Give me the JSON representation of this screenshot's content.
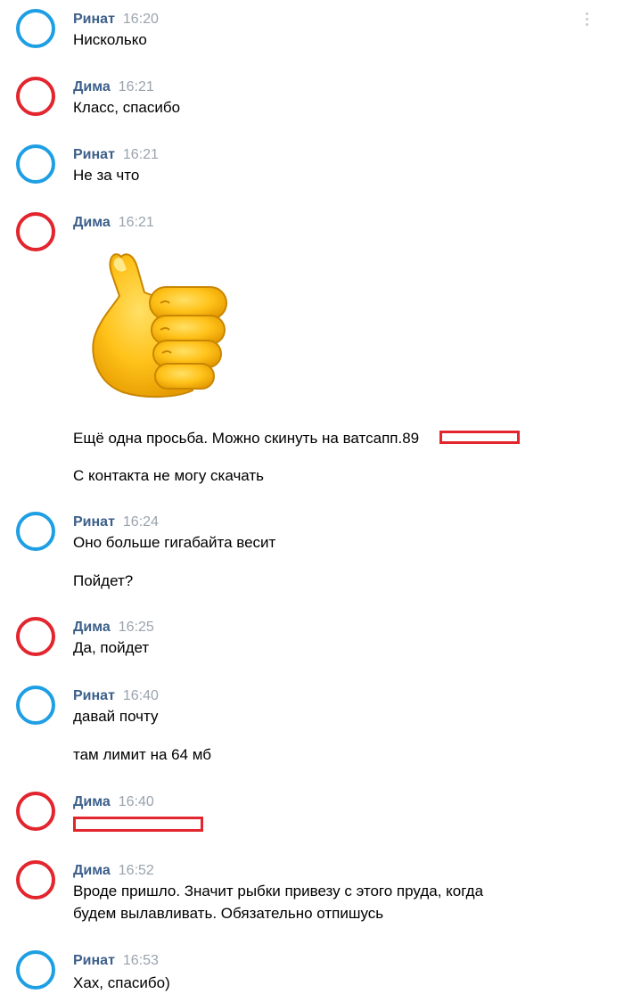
{
  "messages": [
    {
      "author": "Ринат",
      "time": "16:20",
      "lines": [
        "Нисколько"
      ]
    },
    {
      "author": "Дима",
      "time": "16:21",
      "lines": [
        "Класс, спасибо"
      ]
    },
    {
      "author": "Ринат",
      "time": "16:21",
      "lines": [
        "Не за что"
      ]
    },
    {
      "author": "Дима",
      "time": "16:21",
      "sticker": "thumbs-up",
      "lines": [
        "Ещё одна просьба. Можно скинуть на ватсапп.89",
        "С контакта не могу скачать"
      ]
    },
    {
      "author": "Ринат",
      "time": "16:24",
      "lines": [
        "Оно больше гигабайта весит",
        "Пойдет?"
      ]
    },
    {
      "author": "Дима",
      "time": "16:25",
      "lines": [
        "Да, пойдет"
      ]
    },
    {
      "author": "Ринат",
      "time": "16:40",
      "lines": [
        "давай почту",
        "там лимит на 64 мб"
      ]
    },
    {
      "author": "Дима",
      "time": "16:40",
      "lines": []
    },
    {
      "author": "Дима",
      "time": "16:52",
      "lines": [
        "Вроде пришло. Значит рыбки привезу с этого пруда, когда",
        "будем вылавливать. Обязательно отпишусь"
      ]
    },
    {
      "author": "Ринат",
      "time": "16:53",
      "lines": [
        "Хах, спасибо)"
      ]
    }
  ],
  "colors": {
    "avatar_rinat": "#1e9fe4",
    "avatar_dima": "#e3252e",
    "author_name": "#3c5f8a",
    "timestamp": "#9aa3ad",
    "redaction": "#e3252e"
  },
  "icons": [
    "more-icon",
    "thumbs-up-sticker"
  ]
}
